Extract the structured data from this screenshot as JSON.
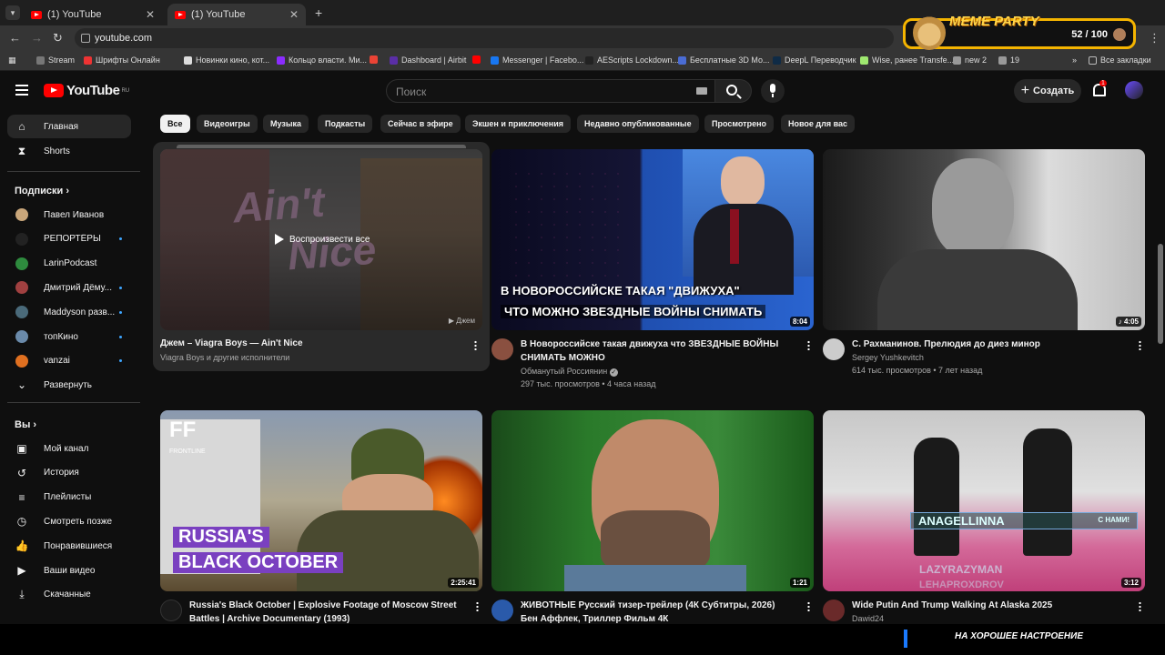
{
  "browser": {
    "tabs": [
      {
        "title": "(1) YouTube",
        "active": false
      },
      {
        "title": "(1) YouTube",
        "active": true
      }
    ],
    "url": "youtube.com",
    "bookmarks": [
      {
        "label": "Stream",
        "color": "#777"
      },
      {
        "label": "Шрифты Онлайн",
        "color": "#e33"
      },
      {
        "label": "Новинки кино, кот...",
        "color": "#ddd"
      },
      {
        "label": "Кольцо власти. Ми...",
        "color": "#8b2cff"
      },
      {
        "label": "",
        "color": "#ea4335"
      },
      {
        "label": "Dashboard | Airbit",
        "color": "#5a2ea6"
      },
      {
        "label": "",
        "color": "#ff0000"
      },
      {
        "label": "Messenger | Facebo...",
        "color": "#1877f2"
      },
      {
        "label": "AEScripts Lockdown...",
        "color": "#222"
      },
      {
        "label": "Бесплатные 3D Мо...",
        "color": "#4a6cd4"
      },
      {
        "label": "DeepL Переводчик",
        "color": "#0f2b46"
      },
      {
        "label": "Wise, ранее Transfe...",
        "color": "#9fe870"
      },
      {
        "label": "new 2",
        "color": "#999"
      },
      {
        "label": "19",
        "color": "#999"
      }
    ],
    "all_bookmarks_label": "Все закладки"
  },
  "overlay": {
    "title": "MEME PARTY",
    "score": "52 / 100",
    "ticker": "НА ХОРОШЕЕ НАСТРОЕНИЕ"
  },
  "header": {
    "logo_text": "YouTube",
    "logo_region": "RU",
    "search_placeholder": "Поиск",
    "create_label": "Создать",
    "notifications_count": "1"
  },
  "sidebar": {
    "main": [
      {
        "label": "Главная",
        "icon": "home-icon",
        "active": true
      },
      {
        "label": "Shorts",
        "icon": "shorts-icon",
        "active": false
      }
    ],
    "subscriptions_heading": "Подписки",
    "subscriptions": [
      {
        "label": "Павел Иванов",
        "color": "#c9a67a",
        "dot": false
      },
      {
        "label": "РЕПОРТЁРЫ",
        "color": "#222",
        "dot": true
      },
      {
        "label": "LarinPodcast",
        "color": "#2e8b3e",
        "dot": false
      },
      {
        "label": "Дмитрий Дёму...",
        "color": "#a04040",
        "dot": true
      },
      {
        "label": "Maddyson разв...",
        "color": "#4a6a7a",
        "dot": true
      },
      {
        "label": "топКино",
        "color": "#6a8aaa",
        "dot": true
      },
      {
        "label": "vanzai",
        "color": "#e07020",
        "dot": true
      }
    ],
    "expand_label": "Развернуть",
    "you_heading": "Вы",
    "you_items": [
      {
        "label": "Мой канал",
        "icon": "my-channel-icon"
      },
      {
        "label": "История",
        "icon": "history-icon"
      },
      {
        "label": "Плейлисты",
        "icon": "playlists-icon"
      },
      {
        "label": "Смотреть позже",
        "icon": "watch-later-icon"
      },
      {
        "label": "Понравившиеся",
        "icon": "liked-icon"
      },
      {
        "label": "Ваши видео",
        "icon": "your-videos-icon"
      },
      {
        "label": "Скачанные",
        "icon": "downloads-icon"
      }
    ]
  },
  "chips": [
    "Все",
    "Видеоигры",
    "Музыка",
    "Подкасты",
    "Сейчас в эфире",
    "Экшен и приключения",
    "Недавно опубликованные",
    "Просмотрено",
    "Новое для вас"
  ],
  "videos": [
    {
      "title": "Джем – Viagra Boys — Ain't Nice",
      "channel": "Viagra Boys и другие исполнители",
      "stats": "",
      "duration": "",
      "mix_label": "Джем",
      "play_all": "Воспроизвести все",
      "thumb_text": [
        "Ain't",
        "Nice"
      ]
    },
    {
      "title": "В Новороссийске такая движуха что ЗВЕЗДНЫЕ ВОЙНЫ СНИМАТЬ МОЖНО",
      "channel": "Обманутый Россиянин",
      "stats": "297 тыс. просмотров • 4 часа назад",
      "duration": "8:04",
      "thumb_text": [
        "В НОВОРОССИЙСКЕ ТАКАЯ \"ДВИЖУХА\"",
        "ЧТО МОЖНО ЗВЕЗДНЫЕ ВОЙНЫ СНИМАТЬ"
      ]
    },
    {
      "title": "С. Рахманинов. Прелюдия до диез минор",
      "channel": "Sergey Yushkevitch",
      "stats": "614 тыс. просмотров • 7 лет назад",
      "duration": "4:05"
    },
    {
      "title": "Russia's Black October | Explosive Footage of Moscow Street Battles | Archive Documentary (1993)",
      "channel": "",
      "stats": "",
      "duration": "2:25:41",
      "thumb_text": [
        "FRONTLINE",
        "RUSSIA'S",
        "BLACK OCTOBER"
      ]
    },
    {
      "title": "ЖИВОТНЫЕ Русский тизер-трейлер (4К Субтитры, 2026) Бен Аффлек, Триллер Фильм 4К",
      "channel": "",
      "stats": "",
      "duration": "1:21"
    },
    {
      "title": "Wide Putin And Trump Walking At Alaska 2025",
      "channel": "Dawid24",
      "stats": "",
      "duration": "3:12",
      "thumb_text": [
        "ANAGELLINNA",
        "С НАМИ!",
        "LAZYRAZYMAN",
        "LEHAPROXDROV"
      ]
    }
  ]
}
